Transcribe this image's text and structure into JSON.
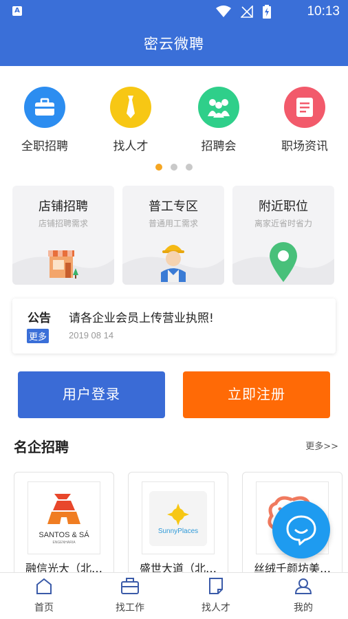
{
  "status_bar": {
    "app_badge": "A",
    "time": "10:13",
    "icons": [
      "wifi-icon",
      "no-signal-icon",
      "battery-charging-icon"
    ]
  },
  "header": {
    "title": "密云微聘"
  },
  "categories": [
    {
      "label": "全职招聘",
      "icon": "briefcase-icon",
      "color": "#2c8df0"
    },
    {
      "label": "找人才",
      "icon": "tie-icon",
      "color": "#f7c714"
    },
    {
      "label": "招聘会",
      "icon": "people-icon",
      "color": "#2fcf8a"
    },
    {
      "label": "职场资讯",
      "icon": "document-icon",
      "color": "#f25a6b"
    }
  ],
  "carousel": {
    "pages": 3,
    "active_index": 0
  },
  "feature_cards": [
    {
      "title": "店铺招聘",
      "subtitle": "店铺招聘需求",
      "icon": "shop-icon"
    },
    {
      "title": "普工专区",
      "subtitle": "普通用工需求",
      "icon": "worker-icon"
    },
    {
      "title": "附近职位",
      "subtitle": "离家近省时省力",
      "icon": "location-pin-icon"
    }
  ],
  "notice": {
    "label": "公告",
    "more": "更多",
    "text": "请各企业会员上传营业执照!",
    "date": "2019 08 14"
  },
  "auth": {
    "login": "用户登录",
    "register": "立即注册"
  },
  "featured_companies": {
    "title": "名企招聘",
    "more": "更多>>",
    "items": [
      {
        "name": "融信光大（北…",
        "logo_text": "SANTOS & SÁ",
        "logo_subtext": "ENGENHARIA"
      },
      {
        "name": "盛世大道（北…",
        "logo_text": "SunnyPlaces"
      },
      {
        "name": "丝绒千颜坊美…",
        "logo_text": ""
      }
    ]
  },
  "tabbar": [
    {
      "label": "首页",
      "icon": "home-icon"
    },
    {
      "label": "找工作",
      "icon": "briefcase-icon"
    },
    {
      "label": "找人才",
      "icon": "resume-icon"
    },
    {
      "label": "我的",
      "icon": "user-icon"
    }
  ],
  "colors": {
    "primary": "#3a6fd8",
    "accent": "#ff6a06",
    "fab": "#1e9bf0",
    "dot_active": "#f5a623"
  }
}
